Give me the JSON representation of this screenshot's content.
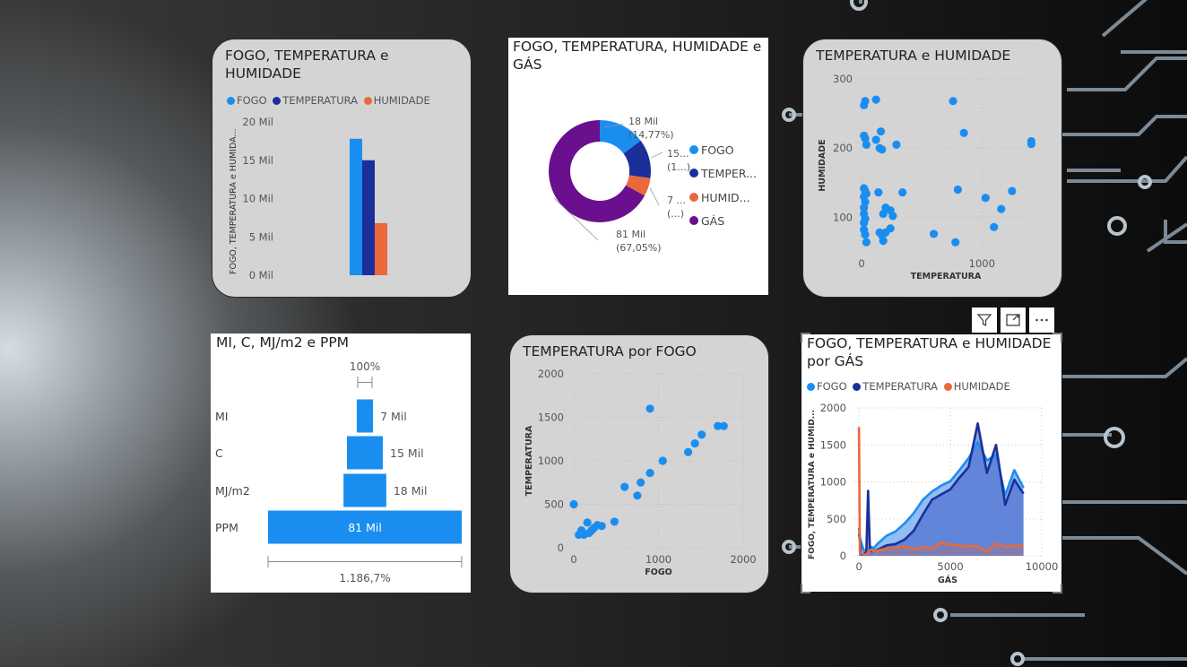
{
  "colors": {
    "fogo": "#1a8ef0",
    "temperatura": "#1b2f9b",
    "humidade": "#e9693a",
    "gas": "#6a0f8e",
    "scatter": "#1a8ef0"
  },
  "cards": {
    "bar_title": "FOGO, TEMPERATURA e HUMIDADE",
    "donut_title": "FOGO, TEMPERATURA, HUMIDADE e GÁS",
    "scatter1_title": "TEMPERATURA e HUMIDADE",
    "funnel_title": "MI, C, MJ/m2 e PPM",
    "scatter2_title": "TEMPERATURA por FOGO",
    "area_title": "FOGO, TEMPERATURA e HUMIDADE por GÁS"
  },
  "legend": {
    "fogo": "FOGO",
    "temperatura": "TEMPERATURA",
    "humidade": "HUMIDADE",
    "gas": "GÁS",
    "temperatura_short": "TEMPER...",
    "humidade_short": "HUMID..."
  },
  "icons": [
    "filter-icon",
    "focus-mode-icon",
    "more-options-icon"
  ],
  "chart_data": [
    {
      "type": "bar",
      "title": "FOGO, TEMPERATURA e HUMIDADE",
      "ylabel": "FOGO, TEMPERATURA e HUMIDA...",
      "ylim": [
        0,
        20000
      ],
      "yticks": [
        "20 Mil",
        "15 Mil",
        "10 Mil",
        "5 Mil",
        "0 Mil"
      ],
      "categories": [
        ""
      ],
      "series": [
        {
          "name": "FOGO",
          "values": [
            17800
          ]
        },
        {
          "name": "TEMPERATURA",
          "values": [
            15000
          ]
        },
        {
          "name": "HUMIDADE",
          "values": [
            6800
          ]
        }
      ],
      "legend": "top-left"
    },
    {
      "type": "pie",
      "title": "FOGO, TEMPERATURA, HUMIDADE e GÁS",
      "slices": [
        {
          "name": "FOGO",
          "value": 17880,
          "percent": 14.77
        },
        {
          "name": "TEMPERATURA",
          "value": 15000,
          "percent": 12.39
        },
        {
          "name": "HUMIDADE",
          "value": 6840,
          "percent": 5.79
        },
        {
          "name": "GÁS",
          "value": 81000,
          "percent": 67.05
        }
      ],
      "labels": [
        {
          "l1": "18 Mil",
          "l2": "(14,77%)"
        },
        {
          "l1": "15...",
          "l2": "(1...)"
        },
        {
          "l1": "7 ...",
          "l2": "(...)"
        },
        {
          "l1": "81 Mil",
          "l2": "(67,05%)"
        }
      ],
      "legend": "right"
    },
    {
      "type": "scatter",
      "title": "TEMPERATURA e HUMIDADE",
      "xlabel": "TEMPERATURA",
      "ylabel": "HUMIDADE",
      "xlim": [
        0,
        1400
      ],
      "ylim": [
        50,
        300
      ],
      "xticks": [
        0,
        1000
      ],
      "yticks": [
        100,
        200,
        300
      ],
      "points": [
        [
          20,
          262
        ],
        [
          30,
          268
        ],
        [
          120,
          270
        ],
        [
          760,
          268
        ],
        [
          850,
          222
        ],
        [
          1410,
          206
        ],
        [
          1410,
          210
        ],
        [
          20,
          218
        ],
        [
          30,
          214
        ],
        [
          40,
          205
        ],
        [
          120,
          212
        ],
        [
          160,
          224
        ],
        [
          150,
          200
        ],
        [
          170,
          198
        ],
        [
          290,
          205
        ],
        [
          20,
          142
        ],
        [
          30,
          138
        ],
        [
          40,
          134
        ],
        [
          20,
          130
        ],
        [
          30,
          122
        ],
        [
          20,
          114
        ],
        [
          20,
          105
        ],
        [
          30,
          98
        ],
        [
          20,
          92
        ],
        [
          140,
          136
        ],
        [
          200,
          114
        ],
        [
          180,
          105
        ],
        [
          240,
          110
        ],
        [
          260,
          102
        ],
        [
          340,
          136
        ],
        [
          800,
          140
        ],
        [
          1030,
          128
        ],
        [
          1250,
          138
        ],
        [
          1160,
          112
        ],
        [
          1100,
          86
        ],
        [
          20,
          82
        ],
        [
          30,
          75
        ],
        [
          40,
          64
        ],
        [
          150,
          78
        ],
        [
          170,
          74
        ],
        [
          200,
          78
        ],
        [
          240,
          84
        ],
        [
          180,
          66
        ],
        [
          600,
          76
        ],
        [
          780,
          64
        ]
      ],
      "grid": true
    },
    {
      "type": "bar",
      "title": "MI, C, MJ/m2 e PPM",
      "categories": [
        "MI",
        "C",
        "MJ/m2",
        "PPM"
      ],
      "values": [
        6800,
        15000,
        17880,
        81000
      ],
      "value_labels": [
        "7 Mil",
        "15 Mil",
        "18 Mil",
        "81 Mil"
      ],
      "top_percent": "100%",
      "bottom_percent": "1.186,7%"
    },
    {
      "type": "scatter",
      "title": "TEMPERATURA por FOGO",
      "xlabel": "FOGO",
      "ylabel": "TEMPERATURA",
      "xlim": [
        0,
        2000
      ],
      "ylim": [
        0,
        2000
      ],
      "xticks": [
        0,
        1000,
        2000
      ],
      "yticks": [
        0,
        500,
        1000,
        1500,
        2000
      ],
      "points": [
        [
          0,
          500
        ],
        [
          60,
          150
        ],
        [
          90,
          200
        ],
        [
          120,
          150
        ],
        [
          160,
          290
        ],
        [
          180,
          170
        ],
        [
          210,
          200
        ],
        [
          240,
          230
        ],
        [
          280,
          260
        ],
        [
          330,
          250
        ],
        [
          480,
          300
        ],
        [
          600,
          700
        ],
        [
          750,
          600
        ],
        [
          790,
          750
        ],
        [
          900,
          860
        ],
        [
          1050,
          1000
        ],
        [
          900,
          1600
        ],
        [
          1350,
          1100
        ],
        [
          1430,
          1200
        ],
        [
          1510,
          1300
        ],
        [
          1700,
          1400
        ],
        [
          1770,
          1400
        ]
      ],
      "grid": true
    },
    {
      "type": "area",
      "title": "FOGO, TEMPERATURA e HUMIDADE por GÁS",
      "xlabel": "GÁS",
      "ylabel": "FOGO, TEMPERATURA e HUMID...",
      "xlim": [
        -300,
        10000
      ],
      "ylim": [
        0,
        2000
      ],
      "xticks": [
        0,
        5000,
        10000
      ],
      "yticks": [
        0,
        500,
        1000,
        1500,
        2000
      ],
      "series": [
        {
          "name": "FOGO",
          "x": [
            0,
            50,
            100,
            200,
            300,
            400,
            500,
            600,
            700,
            800,
            1000,
            1500,
            2000,
            2500,
            3000,
            3500,
            4000,
            4500,
            5000,
            5500,
            6000,
            6500,
            7000,
            7500,
            8000,
            8500,
            9000
          ],
          "values": [
            380,
            260,
            200,
            120,
            60,
            30,
            80,
            90,
            120,
            100,
            160,
            270,
            330,
            440,
            580,
            760,
            870,
            950,
            1010,
            1160,
            1320,
            1540,
            1290,
            1370,
            820,
            1160,
            920
          ]
        },
        {
          "name": "TEMPERATURA",
          "x": [
            0,
            50,
            100,
            200,
            300,
            400,
            500,
            600,
            700,
            800,
            1000,
            1500,
            2000,
            2500,
            3000,
            3500,
            4000,
            4500,
            5000,
            5500,
            6000,
            6500,
            7000,
            7500,
            8000,
            8500,
            9000
          ],
          "values": [
            300,
            220,
            40,
            20,
            30,
            40,
            880,
            90,
            60,
            60,
            80,
            140,
            160,
            220,
            340,
            560,
            760,
            830,
            900,
            1060,
            1200,
            1790,
            1120,
            1500,
            690,
            1030,
            840
          ]
        },
        {
          "name": "HUMIDADE",
          "x": [
            0,
            50,
            100,
            200,
            300,
            400,
            500,
            600,
            700,
            800,
            1000,
            1500,
            2000,
            2500,
            3000,
            3500,
            4000,
            4500,
            5000,
            5500,
            6000,
            6500,
            7000,
            7500,
            8000,
            8500,
            9000
          ],
          "values": [
            1740,
            60,
            40,
            30,
            20,
            10,
            60,
            80,
            80,
            60,
            70,
            100,
            110,
            130,
            90,
            120,
            100,
            180,
            150,
            140,
            130,
            130,
            60,
            170,
            120,
            140,
            140
          ]
        }
      ],
      "legend": "top-left",
      "grid": true
    }
  ]
}
